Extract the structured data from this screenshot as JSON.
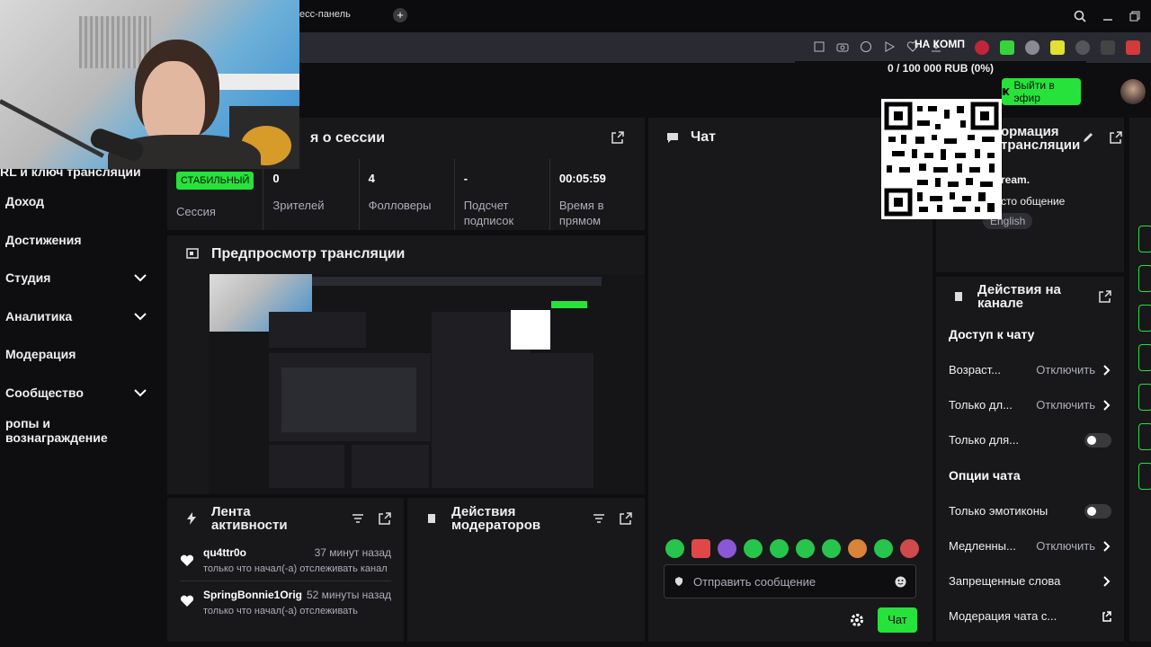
{
  "browser": {
    "tab_title": "есс-панель",
    "ext_label": "НА КОМП",
    "goal": "0 / 100 000 RUB (0%)"
  },
  "header": {
    "go_live": "Выйти в эфир"
  },
  "nav": {
    "items": [
      {
        "label": "RL и ключ трансляции",
        "chevron": false
      },
      {
        "label": "Доход",
        "chevron": false
      },
      {
        "label": "Достижения",
        "chevron": false
      },
      {
        "label": "Студия",
        "chevron": true
      },
      {
        "label": "Аналитика",
        "chevron": true
      },
      {
        "label": "Модерация",
        "chevron": false
      },
      {
        "label": "Сообщество",
        "chevron": true
      },
      {
        "label": "ропы и вознаграждение",
        "chevron": false
      }
    ]
  },
  "session": {
    "title": "я о сессии",
    "badge": "СТАБИЛЬНЫЙ",
    "badge_label": "Сессия",
    "stats": [
      {
        "value": "0",
        "label": "Зрителей"
      },
      {
        "value": "4",
        "label": "Фолловеры"
      },
      {
        "value": "-",
        "label": "Подсчет подписок"
      },
      {
        "value": "00:05:59",
        "label": "Время в прямом"
      }
    ]
  },
  "preview": {
    "title": "Предпросмотр трансляции"
  },
  "activity": {
    "title": "Лента активности",
    "items": [
      {
        "name": "qu4ttr0o",
        "time": "37 минут назад",
        "desc": "только что начал(-а) отслеживать канал"
      },
      {
        "name": "SpringBonnie1Orig",
        "time": "52 минуты назад",
        "desc": "только что начал(-а) отслеживать"
      }
    ]
  },
  "mod_actions": {
    "title": "Действия модераторов"
  },
  "chat": {
    "title": "Чат",
    "placeholder": "Отправить сообщение",
    "send": "Чат"
  },
  "info": {
    "title": "ормация\nтрансляции",
    "line1": "ream.",
    "line2": "сто общение",
    "tag": "English"
  },
  "channel_actions": {
    "title": "Действия на канале",
    "sections": [
      {
        "heading": "Доступ к чату",
        "rows": [
          {
            "label": "Возраст...",
            "value": "Отключить",
            "type": "chevron"
          },
          {
            "label": "Только дл...",
            "value": "Отключить",
            "type": "chevron"
          },
          {
            "label": "Только для...",
            "value": "",
            "type": "toggle"
          }
        ]
      },
      {
        "heading": "Опции чата",
        "rows": [
          {
            "label": "Только эмотиконы",
            "value": "",
            "type": "toggle"
          },
          {
            "label": "Медленны...",
            "value": "Отключить",
            "type": "chevron"
          },
          {
            "label": "Запрещенные слова",
            "value": "",
            "type": "chevron"
          },
          {
            "label": "Модерация чата с...",
            "value": "",
            "type": "external"
          }
        ]
      }
    ]
  },
  "colors": {
    "accent": "#27e23b",
    "panel": "#18181b",
    "bg": "#0e0e10"
  }
}
